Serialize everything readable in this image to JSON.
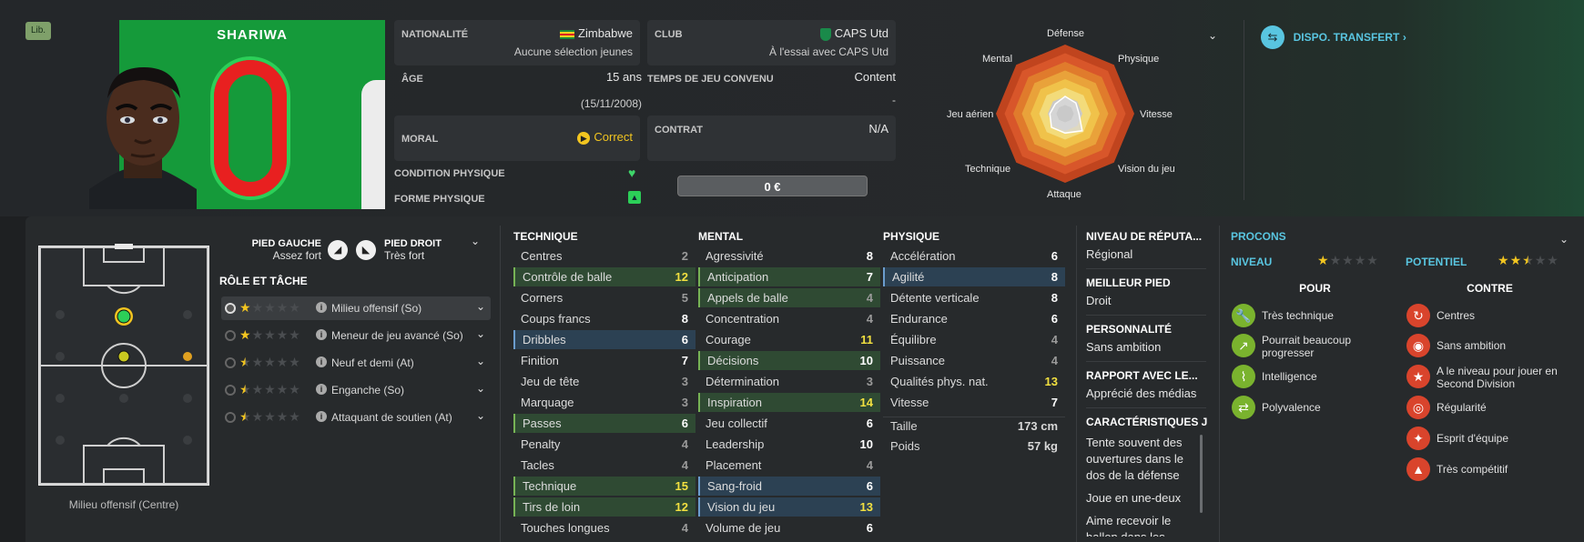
{
  "badge": "Lib.",
  "player": {
    "name": "SHARIWA",
    "number": "0"
  },
  "info": {
    "nationality_label": "NATIONALITÉ",
    "nationality": "Zimbabwe",
    "nationality_sub": "Aucune sélection jeunes",
    "club_label": "CLUB",
    "club": "CAPS Utd",
    "club_sub": "À l'essai avec CAPS Utd",
    "age_label": "ÂGE",
    "age": "15 ans",
    "dob": "(15/11/2008)",
    "playtime_label": "TEMPS DE JEU CONVENU",
    "playtime": "Content",
    "playtime_sub": "-",
    "morale_label": "MORAL",
    "morale": "Correct",
    "contract_label": "CONTRAT",
    "contract": "N/A",
    "condition_label": "CONDITION PHYSIQUE",
    "form_label": "FORME PHYSIQUE",
    "value": "0 €"
  },
  "radar": {
    "labels": [
      "Défense",
      "Physique",
      "Vitesse",
      "Vision du jeu",
      "Attaque",
      "Technique",
      "Jeu aérien",
      "Mental"
    ],
    "player_values": [
      0.25,
      0.22,
      0.2,
      0.35,
      0.28,
      0.28,
      0.22,
      0.2
    ]
  },
  "transfer": {
    "label": "DISPO. TRANSFERT",
    "chevron": "›"
  },
  "pitch": {
    "caption": "Milieu offensif (Centre)"
  },
  "feet": {
    "left_label": "PIED GAUCHE",
    "left_value": "Assez fort",
    "right_label": "PIED DROIT",
    "right_value": "Très fort"
  },
  "roles": {
    "title": "RÔLE ET TÂCHE",
    "items": [
      {
        "name": "Milieu offensif (So)",
        "stars": 1.0
      },
      {
        "name": "Meneur de jeu avancé (So)",
        "stars": 1.0
      },
      {
        "name": "Neuf et demi (At)",
        "stars": 0.5
      },
      {
        "name": "Enganche (So)",
        "stars": 0.5
      },
      {
        "name": "Attaquant de soutien (At)",
        "stars": 0.5
      }
    ]
  },
  "technique": {
    "title": "TECHNIQUE",
    "items": [
      {
        "n": "Centres",
        "v": "2",
        "h": ""
      },
      {
        "n": "Contrôle de balle",
        "v": "12",
        "h": "g"
      },
      {
        "n": "Corners",
        "v": "5",
        "h": ""
      },
      {
        "n": "Coups francs",
        "v": "8",
        "h": ""
      },
      {
        "n": "Dribbles",
        "v": "6",
        "h": "b"
      },
      {
        "n": "Finition",
        "v": "7",
        "h": ""
      },
      {
        "n": "Jeu de tête",
        "v": "3",
        "h": ""
      },
      {
        "n": "Marquage",
        "v": "3",
        "h": ""
      },
      {
        "n": "Passes",
        "v": "6",
        "h": "g"
      },
      {
        "n": "Penalty",
        "v": "4",
        "h": ""
      },
      {
        "n": "Tacles",
        "v": "4",
        "h": ""
      },
      {
        "n": "Technique",
        "v": "15",
        "h": "g"
      },
      {
        "n": "Tirs de loin",
        "v": "12",
        "h": "g"
      },
      {
        "n": "Touches longues",
        "v": "4",
        "h": ""
      }
    ]
  },
  "mental": {
    "title": "MENTAL",
    "items": [
      {
        "n": "Agressivité",
        "v": "8",
        "h": ""
      },
      {
        "n": "Anticipation",
        "v": "7",
        "h": "g"
      },
      {
        "n": "Appels de balle",
        "v": "4",
        "h": "g"
      },
      {
        "n": "Concentration",
        "v": "4",
        "h": ""
      },
      {
        "n": "Courage",
        "v": "11",
        "h": ""
      },
      {
        "n": "Décisions",
        "v": "10",
        "h": "g"
      },
      {
        "n": "Détermination",
        "v": "3",
        "h": ""
      },
      {
        "n": "Inspiration",
        "v": "14",
        "h": "g"
      },
      {
        "n": "Jeu collectif",
        "v": "6",
        "h": ""
      },
      {
        "n": "Leadership",
        "v": "10",
        "h": ""
      },
      {
        "n": "Placement",
        "v": "4",
        "h": ""
      },
      {
        "n": "Sang-froid",
        "v": "6",
        "h": "b"
      },
      {
        "n": "Vision du jeu",
        "v": "13",
        "h": "b"
      },
      {
        "n": "Volume de jeu",
        "v": "6",
        "h": ""
      }
    ]
  },
  "physique": {
    "title": "PHYSIQUE",
    "items": [
      {
        "n": "Accélération",
        "v": "6",
        "h": ""
      },
      {
        "n": "Agilité",
        "v": "8",
        "h": "b"
      },
      {
        "n": "Détente verticale",
        "v": "8",
        "h": ""
      },
      {
        "n": "Endurance",
        "v": "6",
        "h": ""
      },
      {
        "n": "Équilibre",
        "v": "4",
        "h": ""
      },
      {
        "n": "Puissance",
        "v": "4",
        "h": ""
      },
      {
        "n": "Qualités phys. nat.",
        "v": "13",
        "h": ""
      },
      {
        "n": "Vitesse",
        "v": "7",
        "h": ""
      }
    ],
    "height_label": "Taille",
    "height": "173 cm",
    "weight_label": "Poids",
    "weight": "57 kg"
  },
  "profile": {
    "rep_label": "NIVEAU DE RÉPUTA...",
    "rep": "Régional",
    "foot_label": "MEILLEUR PIED",
    "foot": "Droit",
    "pers_label": "PERSONNALITÉ",
    "pers": "Sans ambition",
    "media_label": "RAPPORT AVEC LE...",
    "media": "Apprécié des médias",
    "traits_label": "CARACTÉRISTIQUES J",
    "traits": [
      "Tente souvent des ouvertures dans le dos de la défense",
      "Joue en une-deux",
      "Aime recevoir le ballon dans les"
    ]
  },
  "procons": {
    "title": "PROCONS",
    "level_label": "NIVEAU",
    "level_stars": 1,
    "potential_label": "POTENTIEL",
    "potential_stars": 2.5,
    "pros_label": "POUR",
    "cons_label": "CONTRE",
    "pros": [
      "Très technique",
      "Pourrait beaucoup progresser",
      "Intelligence",
      "Polyvalence"
    ],
    "cons": [
      "Centres",
      "Sans ambition",
      "A le niveau pour jouer en Second Division",
      "Régularité",
      "Esprit d'équipe",
      "Très compétitif"
    ]
  },
  "colors": {
    "accent": "#f2c520",
    "pro": "#7ab32e",
    "con": "#d9442c",
    "transfer": "#59c5e0"
  }
}
